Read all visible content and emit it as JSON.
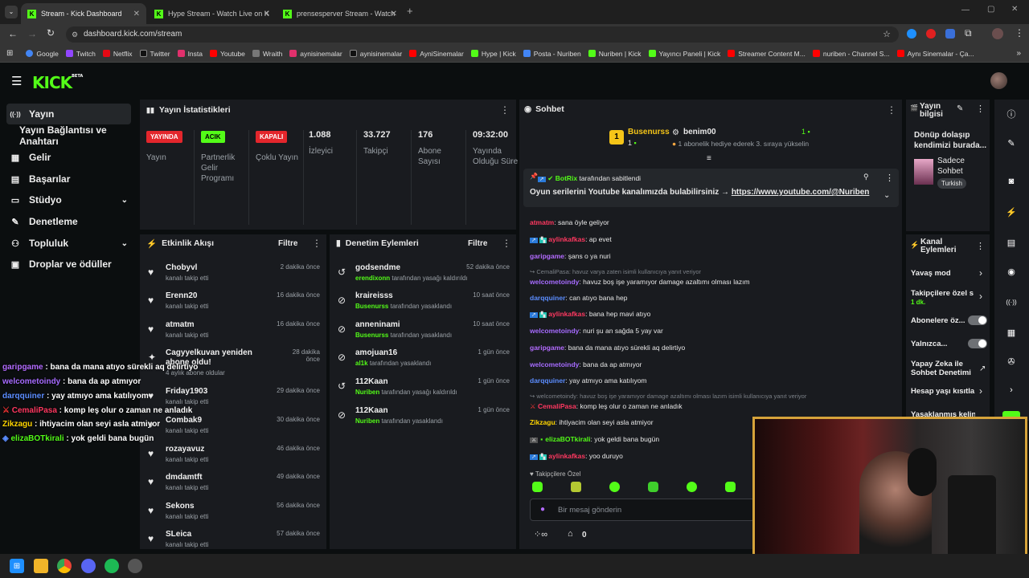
{
  "browser": {
    "tabs": [
      {
        "title": "Stream - Kick Dashboard",
        "active": true
      },
      {
        "title": "Hype Stream - Watch Live on K",
        "active": false
      },
      {
        "title": "prensesperver Stream - Watch",
        "active": false
      }
    ],
    "new_tab": "+",
    "url": "dashboard.kick.com/stream",
    "bookmarks": [
      "Google",
      "Twitch",
      "Netflix",
      "Twitter",
      "Insta",
      "Youtube",
      "Wraith",
      "aynisinemalar",
      "aynisinemalar",
      "AyniSinemalar",
      "Hype | Kick",
      "Posta - Nuriben",
      "Nuriben | Kick",
      "Yayıncı Paneli | Kick",
      "Streamer Content M...",
      "nuriben - Channel S...",
      "Aynı Sinemalar - Ça..."
    ]
  },
  "header": {
    "logo": "KICK",
    "logo_sup": "BETA"
  },
  "sidebar": {
    "items": [
      {
        "label": "Yayın",
        "icon": "broadcast-icon",
        "glyph": "((·))"
      },
      {
        "label": "Yayın Bağlantısı ve Anahtarı",
        "icon": "",
        "glyph": ""
      },
      {
        "label": "Gelir",
        "icon": "revenue-icon",
        "glyph": "▦"
      },
      {
        "label": "Başarılar",
        "icon": "achievements-icon",
        "glyph": "▤"
      },
      {
        "label": "Stüdyo",
        "icon": "studio-icon",
        "glyph": "▭"
      },
      {
        "label": "Denetleme",
        "icon": "wrench-icon",
        "glyph": "✎"
      },
      {
        "label": "Topluluk",
        "icon": "community-icon",
        "glyph": "👥"
      },
      {
        "label": "Droplar ve ödüller",
        "icon": "gift-icon",
        "glyph": "▣"
      }
    ]
  },
  "stats": {
    "title": "Yayın İstatistikleri",
    "cols": [
      {
        "badge": "YAYINDA",
        "label": "Yayın",
        "color": "#e3262c",
        "fg": "#ffffff"
      },
      {
        "badge": "ACIK",
        "label": "Partnerlik Gelir Programı",
        "color": "#53fc18",
        "fg": "#000000"
      },
      {
        "badge": "KAPALI",
        "label": "Çoklu Yayın",
        "color": "#e3262c",
        "fg": "#ffffff"
      },
      {
        "value": "1.088",
        "label": "İzleyici"
      },
      {
        "value": "33.727",
        "label": "Takipçi"
      },
      {
        "value": "176",
        "label": "Abone Sayısı"
      },
      {
        "value": "09:32:00",
        "label": "Yayında Olduğu Süre"
      }
    ]
  },
  "activity": {
    "title": "Etkinlik Akışı",
    "filter": "Filtre",
    "items": [
      {
        "name": "Chobyvl",
        "sub": "kanalı takip etti",
        "time": "2 dakika önce"
      },
      {
        "name": "Erenn20",
        "sub": "kanalı takip etti",
        "time": "16 dakika önce"
      },
      {
        "name": "atmatm",
        "sub": "kanalı takip etti",
        "time": "16 dakika önce"
      },
      {
        "name": "Cagyyelkuvan yeniden abone oldu!",
        "sub": "4 aylık abone oldular",
        "time": "28 dakika önce"
      },
      {
        "name": "Friday1903",
        "sub": "kanalı takip etti",
        "time": "29 dakika önce"
      },
      {
        "name": "Combak9",
        "sub": "kanalı takip etti",
        "time": "30 dakika önce"
      },
      {
        "name": "rozayavuz",
        "sub": "kanalı takip etti",
        "time": "46 dakika önce"
      },
      {
        "name": "dmdamtft",
        "sub": "kanalı takip etti",
        "time": "49 dakika önce"
      },
      {
        "name": "Sekons",
        "sub": "kanalı takip etti",
        "time": "56 dakika önce"
      },
      {
        "name": "SLeica",
        "sub": "kanalı takip etti",
        "time": "57 dakika önce"
      }
    ]
  },
  "moderation": {
    "title": "Denetim Eylemleri",
    "filter": "Filtre",
    "items": [
      {
        "name": "godsendme",
        "actor": "erendixonn",
        "action": "tarafından yasağı kaldırıldı",
        "time": "52 dakika önce"
      },
      {
        "name": "kraireisss",
        "actor": "Busenurss",
        "action": "tarafından yasaklandı",
        "time": "10 saat önce"
      },
      {
        "name": "anneninami",
        "actor": "Busenurss",
        "action": "tarafından yasaklandı",
        "time": "10 saat önce"
      },
      {
        "name": "amojuan16",
        "actor": "al1k",
        "action": "tarafından yasaklandı",
        "time": "1 gün önce"
      },
      {
        "name": "112Kaan",
        "actor": "Nuriben",
        "action": "tarafından yasağı kaldırıldı",
        "time": "1 gün önce"
      },
      {
        "name": "112Kaan",
        "actor": "Nuriben",
        "action": "tarafından yasaklandı",
        "time": "1 gün önce"
      }
    ]
  },
  "chat": {
    "title": "Sohbet",
    "gift_user": "Busenurss",
    "gift_rank": "1",
    "gift_count": "1",
    "gift_user2": "benim00",
    "gift_count2": "1",
    "gift_msg": "1 abonelik hediye ederek 3. sıraya yükselin",
    "pinned_by": "BotRix",
    "pinned_suffix": "tarafından sabitlendi",
    "pinned_text": "Oyun serilerini Youtube kanalımızda bulabilirsiniz →",
    "pinned_link": "https://www.youtube.com/@Nuriben",
    "messages": [
      {
        "user": "atmatm",
        "color": "#ff3860",
        "text": "sana öyle geliyor"
      },
      {
        "user": "aylinkafkas",
        "color": "#ff3860",
        "text": "ap evet"
      },
      {
        "user": "garipgame",
        "color": "#b36bff",
        "text": "şans o ya nuri"
      },
      {
        "user": "",
        "color": "",
        "text": "CemaliPasa: havuz varya zaten isimli kullanıcıya yanıt veriyor"
      },
      {
        "user": "welcometoindy",
        "color": "#a66bff",
        "text": "havuz boş işe yaramıyor damage azaltımı olması lazım"
      },
      {
        "user": "darqquiner",
        "color": "#5b8dff",
        "text": "can atıyo bana hep"
      },
      {
        "user": "aylinkafkas",
        "color": "#ff3860",
        "text": "bana hep mavi atıyo"
      },
      {
        "user": "welcometoindy",
        "color": "#a66bff",
        "text": "nuri şu an sağda 5 yay var"
      },
      {
        "user": "garipgame",
        "color": "#b36bff",
        "text": "bana da mana atıyo sürekli aq delirtiyo"
      },
      {
        "user": "welcometoindy",
        "color": "#a66bff",
        "text": "bana da ap atmıyor"
      },
      {
        "user": "darqquiner",
        "color": "#5b8dff",
        "text": "yay atmıyo ama katılıyom"
      },
      {
        "user": "",
        "color": "",
        "text": "welcometoindy: havuz boş işe yaramıyor damage azaltımı olması lazım isimli kullanıcıya yanıt veriyor"
      },
      {
        "user": "CemaliPasa",
        "color": "#ff3860",
        "text": "komp leş olur o zaman ne anladık"
      },
      {
        "user": "Zikzagu",
        "color": "#ffd500",
        "text": "ihtiyacim olan seyi asla atmiyor"
      },
      {
        "user": "elizaBOTkirali",
        "color": "#53fc18",
        "text": "yok geldi bana bugün"
      },
      {
        "user": "aylinkafkas",
        "color": "#ff3860",
        "text": "yoo duruyo"
      }
    ],
    "followers_only": "Takipçilere Özel",
    "placeholder": "Bir mesaj gönderin",
    "points": "0"
  },
  "overlay_chat": [
    {
      "user": "garipgame",
      "color": "#b36bff",
      "text": "bana da mana atıyo sürekli aq delirtiyo"
    },
    {
      "user": "welcometoindy",
      "color": "#a66bff",
      "text": "bana da ap atmıyor"
    },
    {
      "user": "darqquiner",
      "color": "#5b8dff",
      "text": "yay atmıyo ama katılıyom"
    },
    {
      "user": "CemaliPasa",
      "color": "#ff3860",
      "text": "komp leş olur o zaman ne anladık"
    },
    {
      "user": "Zikzagu",
      "color": "#ffd500",
      "text": "ihtiyacim olan seyi asla atmiyor"
    },
    {
      "user": "elizaBOTkirali",
      "color": "#53fc18",
      "text": "yok geldi bana bugün"
    }
  ],
  "stream_info": {
    "title": "Yayın bilgisi",
    "stream_title": "Dönüp dolaşıp kendimizi burada...",
    "category": "Sadece Sohbet",
    "language": "Turkish"
  },
  "channel_actions": {
    "title": "Kanal Eylemleri",
    "slow_mode": "Yavaş mod",
    "followers": "Takipçilere özel s",
    "followers_sub": "1 dk.",
    "subs": "Abonelere öz...",
    "solo": "Yalnızca...",
    "ai_mod": "Yapay Zeka ile Sohbet Denetimi",
    "age": "Hesap yaşı kısıtla",
    "banned": "Yasaklanmış kelin"
  }
}
